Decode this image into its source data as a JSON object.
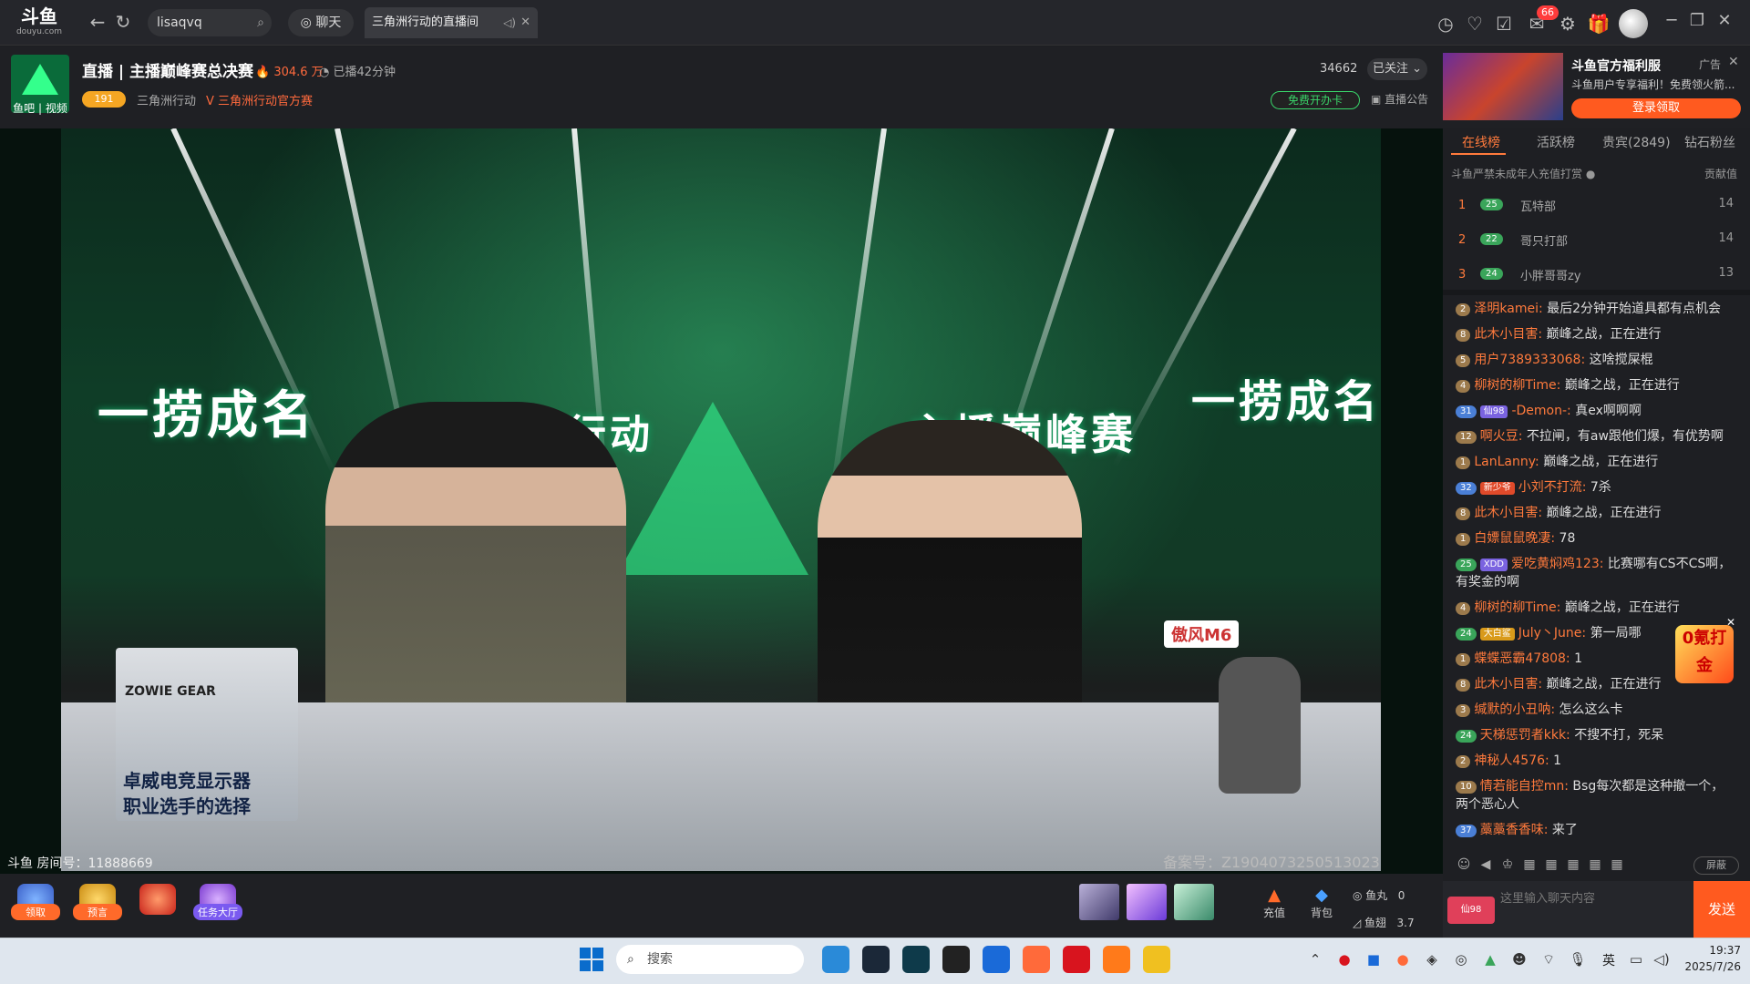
{
  "topbar": {
    "logo_brand": "斗鱼",
    "logo_sub": "douyu.com",
    "search_value": "lisaqvq",
    "chat_tab": "聊天",
    "room_tab": "三角洲行动的直播间",
    "notif_count": "66"
  },
  "room": {
    "avatar_label": "鱼吧 | 视频",
    "title": "直播 | 主播巅峰赛总决赛",
    "heat": "304.6 万",
    "live_duration": "已播42分钟",
    "level_badge": "191",
    "category": "三角洲行动",
    "official_tag": "三角洲行动官方赛",
    "follow_count": "34662",
    "follow_btn": "已关注",
    "free_card": "免费开办卡",
    "announcement": "直播公告",
    "room_id_label": "斗鱼 房间号：11888669",
    "icp": "备案号：Z1904073250513023"
  },
  "stage": {
    "text_left": "一捞成名",
    "text_center": "三角洲行动",
    "text_right": "主播巅峰赛",
    "text_far_right": "一捞成名",
    "monitor_brand": "ZOWIE GEAR",
    "monitor_line1": "卓威电竞显示器",
    "monitor_line2": "职业选手的选择",
    "chair_label": "傲风M6"
  },
  "ad": {
    "title": "斗鱼官方福利服",
    "tag": "广告",
    "desc": "斗鱼用户专享福利！免费领火箭...",
    "button": "登录领取"
  },
  "panel": {
    "tabs": [
      "在线榜",
      "活跃榜",
      "贵宾(2849)",
      "钻石粉丝"
    ],
    "minor_note": "斗鱼严禁未成年人充值打赏",
    "contrib_label": "贡献值",
    "ranking": [
      {
        "rank": "1",
        "level": "25",
        "name": "瓦特部",
        "score": "14"
      },
      {
        "rank": "2",
        "level": "22",
        "name": "哥只打部",
        "score": "14"
      },
      {
        "rank": "3",
        "level": "24",
        "name": "小胖哥哥zy",
        "score": "13"
      }
    ],
    "messages": [
      {
        "lv": "2",
        "fan": "",
        "user": "泽明kamei:",
        "text": " 最后2分钟开始道具都有点机会"
      },
      {
        "lv": "8",
        "fan": "",
        "user": "此木小目害:",
        "text": " 巅峰之战，正在进行"
      },
      {
        "lv": "5",
        "fan": "",
        "user": "用户7389333068:",
        "text": " 这啥搅屎棍"
      },
      {
        "lv": "4",
        "fan": "",
        "user": "柳树的柳Time:",
        "text": " 巅峰之战，正在进行"
      },
      {
        "lv": "31",
        "fan": "仙98",
        "user": "-Demon-:",
        "text": " 真ex啊啊啊"
      },
      {
        "lv": "12",
        "fan": "",
        "user": "啊火豆:",
        "text": " 不拉闸，有aw跟他们爆，有优势啊"
      },
      {
        "lv": "1",
        "fan": "",
        "user": "LanLanny:",
        "text": " 巅峰之战，正在进行"
      },
      {
        "lv": "32",
        "fan": "新少爷",
        "user": "小刘不打流:",
        "text": " 7杀"
      },
      {
        "lv": "8",
        "fan": "",
        "user": "此木小目害:",
        "text": " 巅峰之战，正在进行"
      },
      {
        "lv": "1",
        "fan": "",
        "user": "白嫖鼠鼠晚凄:",
        "text": " 78"
      },
      {
        "lv": "25",
        "fan": "XDD",
        "user": "爱吃黄焖鸡123:",
        "text": " 比赛哪有CS不CS啊，有奖金的啊"
      },
      {
        "lv": "4",
        "fan": "",
        "user": "柳树的柳Time:",
        "text": " 巅峰之战，正在进行"
      },
      {
        "lv": "24",
        "fan": "大白鲨",
        "user": "July丶June:",
        "text": " 第一局哪"
      },
      {
        "lv": "1",
        "fan": "",
        "user": "蝶蝶恶霸47808:",
        "text": " 1"
      },
      {
        "lv": "8",
        "fan": "",
        "user": "此木小目害:",
        "text": " 巅峰之战，正在进行"
      },
      {
        "lv": "3",
        "fan": "",
        "user": "缄默的小丑呐:",
        "text": " 怎么这么卡"
      },
      {
        "lv": "24",
        "fan": "",
        "user": "天梯惩罚者kkk:",
        "text": " 不搜不打，死呆"
      },
      {
        "lv": "2",
        "fan": "",
        "user": "神秘人4576:",
        "text": " 1"
      },
      {
        "lv": "10",
        "fan": "",
        "user": "情若能自控mn:",
        "text": " Bsg每次都是这种撤一个，两个恶心人"
      },
      {
        "lv": "37",
        "fan": "",
        "user": "藁藁香香味:",
        "text": " 来了"
      }
    ],
    "float_ad": "0氪打金",
    "block_btn": "屏蔽",
    "input_placeholder": "这里输入聊天内容",
    "user_chip": "仙98",
    "send": "发送"
  },
  "bottom_tools": [
    {
      "label": "领取"
    },
    {
      "label": "预言"
    },
    {
      "label": ""
    },
    {
      "label": "任务大厅"
    }
  ],
  "bottom_right": {
    "recharge": "充值",
    "backpack": "背包",
    "fishball_label": "鱼丸",
    "fishball_value": "0",
    "fishwing_label": "鱼翅",
    "fishwing_value": "3.7"
  },
  "taskbar": {
    "search": "搜索",
    "ime": "英",
    "time": "19:37",
    "date": "2025/7/26"
  }
}
